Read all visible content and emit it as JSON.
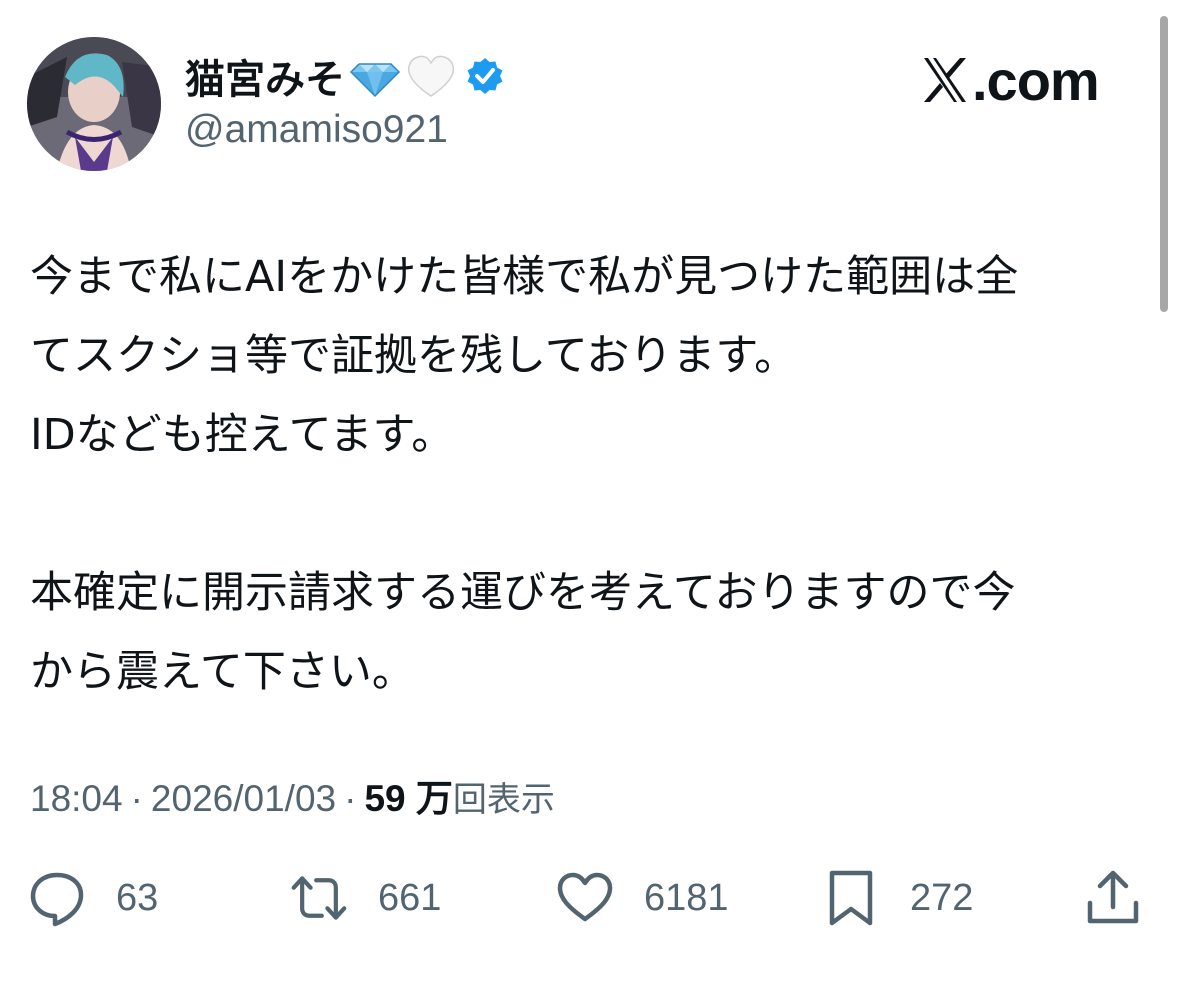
{
  "profile": {
    "display_name": "猫宮みそ",
    "handle": "@amamiso921",
    "badges": [
      "gem-emoji",
      "white-heart-emoji",
      "verified-badge"
    ]
  },
  "brand": {
    "label": ".com",
    "icon": "x-logo"
  },
  "tweet": {
    "lines": [
      "今まで私にAIをかけた皆様で私が見つけた範囲は全",
      "てスクショ等で証拠を残しております。",
      "IDなども控えてます。",
      "",
      "本確定に開示請求する運びを考えておりますので今",
      "から震えて下さい。"
    ]
  },
  "meta": {
    "time": "18:04",
    "date": "2026/01/03",
    "separator": "·",
    "views_count": "59 万",
    "views_label": "回表示"
  },
  "actions": {
    "replies": "63",
    "reposts": "661",
    "likes": "6181",
    "bookmarks": "272"
  },
  "colors": {
    "text": "#0f1419",
    "secondary": "#536471",
    "verified": "#1d9bf0"
  }
}
